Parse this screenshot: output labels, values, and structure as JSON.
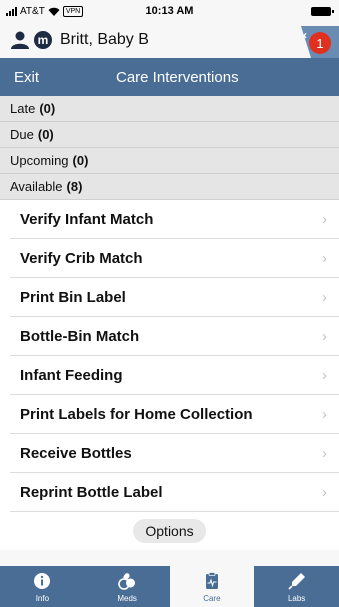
{
  "status_bar": {
    "carrier": "AT&T",
    "vpn": "VPN",
    "time": "10:13 AM"
  },
  "patient": {
    "badge": "m",
    "name": "Britt, Baby B",
    "alert_count": "1"
  },
  "nav": {
    "exit_label": "Exit",
    "title": "Care Interventions"
  },
  "sections": [
    {
      "label": "Late",
      "count": "(0)"
    },
    {
      "label": "Due",
      "count": "(0)"
    },
    {
      "label": "Upcoming",
      "count": "(0)"
    },
    {
      "label": "Available",
      "count": "(8)"
    }
  ],
  "interventions": [
    {
      "label": "Verify Infant Match"
    },
    {
      "label": "Verify Crib Match"
    },
    {
      "label": "Print Bin Label"
    },
    {
      "label": "Bottle-Bin Match"
    },
    {
      "label": "Infant Feeding"
    },
    {
      "label": "Print Labels for Home Collection"
    },
    {
      "label": "Receive Bottles"
    },
    {
      "label": "Reprint Bottle Label"
    }
  ],
  "options_label": "Options",
  "tabs": [
    {
      "label": "Info",
      "icon": "info-icon",
      "active": false
    },
    {
      "label": "Meds",
      "icon": "pills-icon",
      "active": false
    },
    {
      "label": "Care",
      "icon": "clipboard-icon",
      "active": true
    },
    {
      "label": "Labs",
      "icon": "flask-icon",
      "active": false
    }
  ],
  "colors": {
    "nav_blue": "#4a6d96",
    "alert_red": "#e0301e",
    "section_gray": "#e5e5e5"
  }
}
